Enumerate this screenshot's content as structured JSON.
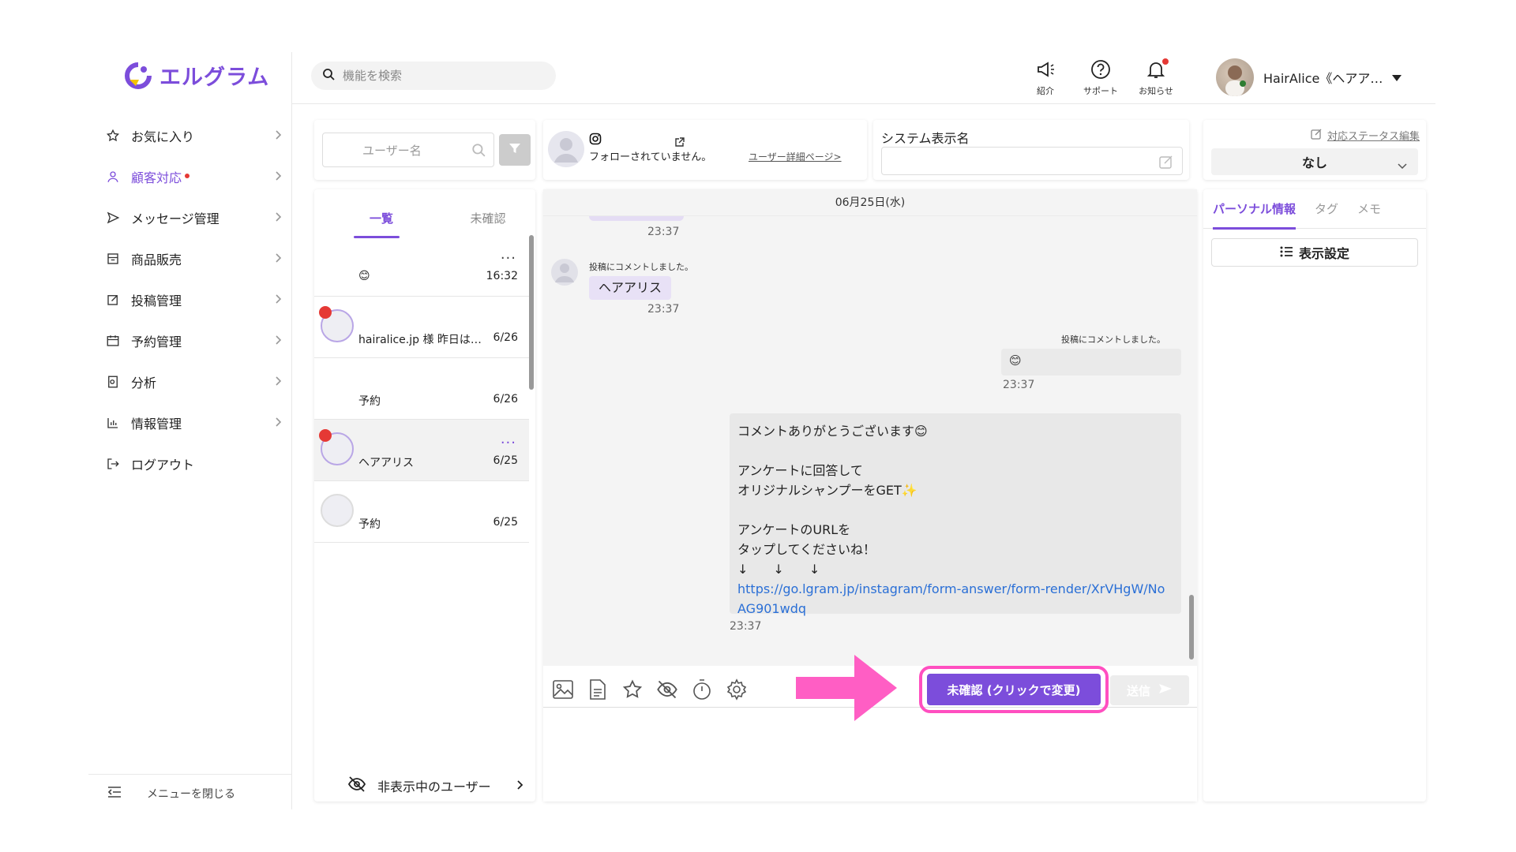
{
  "app": {
    "logo_text": "エルグラム"
  },
  "sidebar": {
    "items": [
      {
        "label": "お気に入り"
      },
      {
        "label": "顧客対応"
      },
      {
        "label": "メッセージ管理"
      },
      {
        "label": "商品販売"
      },
      {
        "label": "投稿管理"
      },
      {
        "label": "予約管理"
      },
      {
        "label": "分析"
      },
      {
        "label": "情報管理"
      },
      {
        "label": "ログアウト"
      }
    ],
    "close_menu": "メニューを閉じる"
  },
  "topbar": {
    "search_placeholder": "機能を検索",
    "icons": [
      {
        "label": "紹介"
      },
      {
        "label": "サポート"
      },
      {
        "label": "お知らせ"
      }
    ],
    "user_name": "HairAlice《ヘアア…"
  },
  "user_search": {
    "placeholder": "ユーザー名"
  },
  "user_info": {
    "follow_status": "フォローされていません。",
    "detail_link": "ユーザー詳細ページ>"
  },
  "system_name": {
    "label": "システム表示名",
    "value": ""
  },
  "status": {
    "edit_label": "対応ステータス編集",
    "value": "なし"
  },
  "chat_list": {
    "tabs": [
      "一覧",
      "未確認"
    ],
    "conversations": [
      {
        "text": "😊",
        "time": "16:32",
        "unread": false,
        "more": "..."
      },
      {
        "text": "hairalice.jp 様 昨日は…",
        "time": "6/26",
        "unread": true,
        "more": ""
      },
      {
        "text": "予約",
        "time": "6/26",
        "unread": false,
        "more": ""
      },
      {
        "text": "ヘアアリス",
        "time": "6/25",
        "unread": true,
        "more": "..."
      },
      {
        "text": "予約",
        "time": "6/25",
        "unread": false,
        "more": ""
      }
    ],
    "hidden_users": "非表示中のユーザー"
  },
  "chat": {
    "date": "06月25日(水)",
    "messages": [
      {
        "time": "23:37"
      },
      {
        "note": "投稿にコメントしました。",
        "text": "ヘアアリス",
        "time": "23:37"
      },
      {
        "note": "投稿にコメントしました。",
        "text": "😊",
        "time": "23:37"
      },
      {
        "lines": [
          "コメントありがとうございます😊",
          "",
          "アンケートに回答して",
          "オリジナルシャンプーをGET✨",
          "",
          "アンケートのURLを",
          "タップしてくださいね！",
          "↓　　↓　　↓"
        ],
        "link": "https://go.lgram.jp/instagram/form-answer/form-render/XrVHgW/NoAG901wdq",
        "time": "23:37"
      }
    ],
    "unread_button": "未確認 (クリックで変更)",
    "send_button": "送信"
  },
  "right_panel": {
    "tabs": [
      "パーソナル情報",
      "タグ",
      "メモ"
    ],
    "display_settings": "表示設定"
  },
  "colors": {
    "accent": "#7c4ddb",
    "highlight": "#ff4fc0",
    "alert": "#e53935"
  }
}
